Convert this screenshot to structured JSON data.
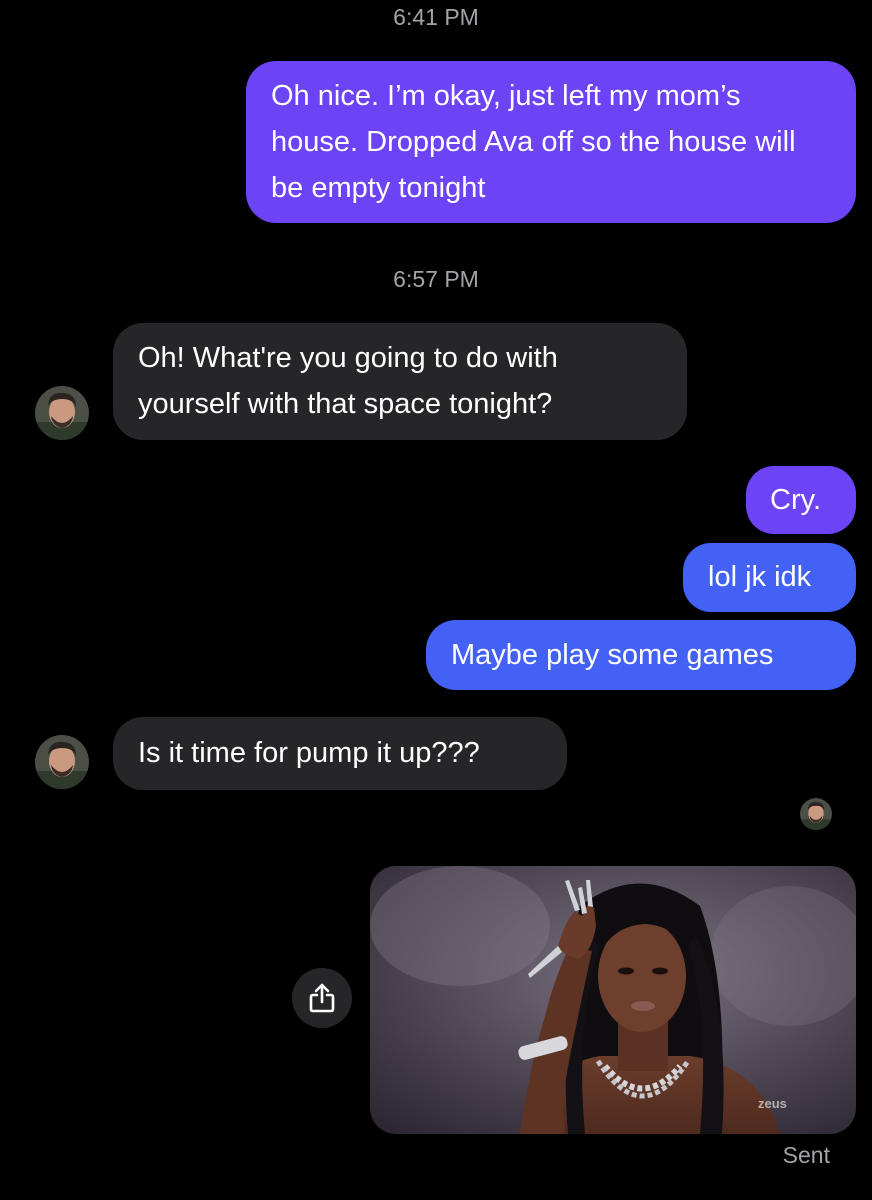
{
  "chat": {
    "timestamps": [
      "6:41 PM",
      "6:57 PM"
    ],
    "messages": [
      {
        "from": "me",
        "text": "Oh nice. I’m okay, just left my mom’s house. Dropped Ava off so the house will be empty tonight"
      },
      {
        "from": "them",
        "text": "Oh!  What're you going to do with yourself with that space tonight?"
      },
      {
        "from": "me",
        "text": "Cry."
      },
      {
        "from": "me",
        "text": "lol jk idk"
      },
      {
        "from": "me",
        "text": "Maybe play some games"
      },
      {
        "from": "them",
        "text": "Is it time for pump it up???"
      }
    ],
    "media": {
      "watermark": "zeus"
    },
    "status": "Sent"
  },
  "colors": {
    "background": "#000000",
    "outgoing_purple": "#6c43f5",
    "outgoing_blue": "#4461f5",
    "incoming": "#262629",
    "meta_text": "#a3a3a8"
  },
  "icons": {
    "share": "share-icon",
    "avatar": "contact-avatar"
  }
}
